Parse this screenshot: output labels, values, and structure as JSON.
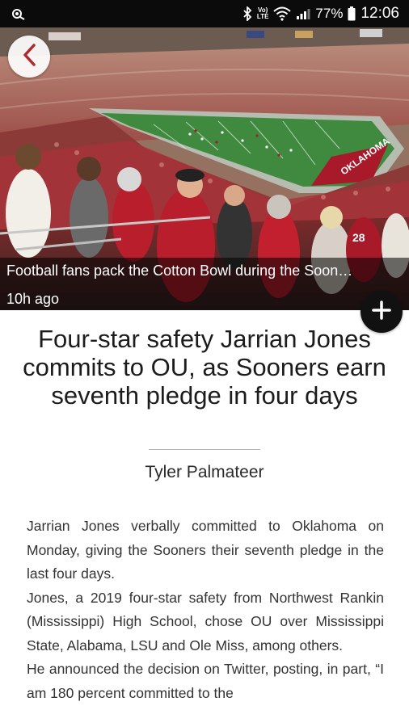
{
  "status_bar": {
    "battery_percent": "77%",
    "time": "12:06",
    "network_label_top": "Vo)",
    "network_label_bottom": "LTE",
    "icons": [
      "location-icon",
      "bluetooth-icon",
      "volte-icon",
      "wifi-icon",
      "signal-icon",
      "battery-icon"
    ]
  },
  "hero": {
    "caption": "Football fans pack the Cotton Bowl during the Soon…",
    "time_ago": "10h ago",
    "end_zone_text": "OKLAHOMA",
    "jersey_number": "28"
  },
  "article": {
    "headline": "Four-star safety Jarrian Jones commits to OU, as Sooners earn seventh pledge in four days",
    "author": "Tyler Palmateer",
    "paragraphs": [
      "Jarrian Jones verbally committed to Oklahoma on Monday, giving the Sooners their seventh pledge in the last four days.",
      "Jones, a 2019 four-star safety from Northwest Rankin (Mississippi) High School, chose OU over Mississippi State, Alabama, LSU and Ole Miss, among others.",
      "He announced the decision on Twitter, posting, in part, “I am 180 percent committed to the"
    ]
  },
  "colors": {
    "status_bar_bg": "#0b0b0b",
    "back_arrow": "#b0282d",
    "add_button_bg": "#111111",
    "crimson": "#a8192a",
    "field_green": "#3f8a3f"
  }
}
